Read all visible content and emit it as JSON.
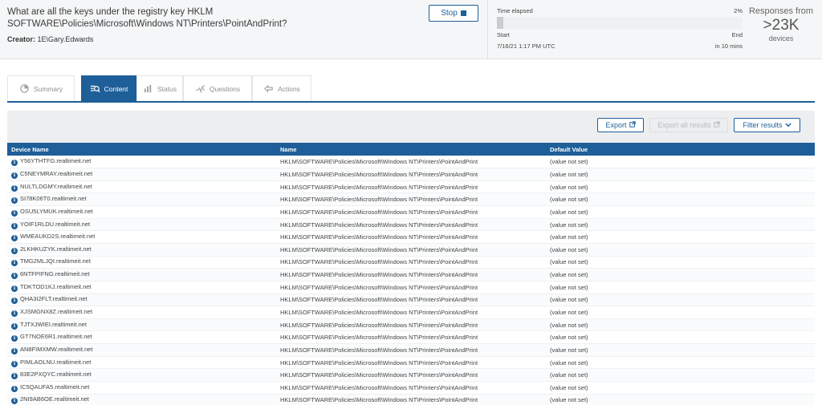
{
  "header": {
    "question": "What are all the keys under the registry key HKLM SOFTWARE\\Policies\\Microsoft\\Windows NT\\Printers\\PointAndPrint?",
    "creator_label": "Creator:",
    "creator_value": "1E\\Gary.Edwards",
    "stop_label": "Stop",
    "time_elapsed_label": "Time elapsed",
    "time_elapsed_percent": "2%",
    "progress_fraction": 0.02,
    "start_label": "Start",
    "end_label": "End",
    "start_time": "7/16/21 1:17 PM UTC",
    "end_time": "in 10 mins",
    "responses_label": "Responses from",
    "responses_count": ">23K",
    "responses_unit": "devices"
  },
  "tabs": [
    {
      "label": "Summary",
      "icon": "summary-icon",
      "active": false
    },
    {
      "label": "Content",
      "icon": "content-icon",
      "active": true
    },
    {
      "label": "Status",
      "icon": "status-icon",
      "active": false
    },
    {
      "label": "Questions",
      "icon": "questions-icon",
      "active": false
    },
    {
      "label": "Actions",
      "icon": "actions-icon",
      "active": false
    }
  ],
  "toolbar": {
    "export_label": "Export",
    "export_all_label": "Export all results",
    "filter_label": "Filter results"
  },
  "table": {
    "columns": [
      "Device Name",
      "Name",
      "Default Value"
    ],
    "rows": [
      {
        "device": "Y56YTHTFG.realtimeit.net",
        "name": "HKLM\\SOFTWARE\\Policies\\Microsoft\\Windows NT\\Printers\\PointAndPrint",
        "value": "(value not set)"
      },
      {
        "device": "C5NEYMRAY.realtimeit.net",
        "name": "HKLM\\SOFTWARE\\Policies\\Microsoft\\Windows NT\\Printers\\PointAndPrint",
        "value": "(value not set)"
      },
      {
        "device": "NULTLDGMY.realtimeit.net",
        "name": "HKLM\\SOFTWARE\\Policies\\Microsoft\\Windows NT\\Printers\\PointAndPrint",
        "value": "(value not set)"
      },
      {
        "device": "SI78K06T0.realtimeit.net",
        "name": "HKLM\\SOFTWARE\\Policies\\Microsoft\\Windows NT\\Printers\\PointAndPrint",
        "value": "(value not set)"
      },
      {
        "device": "OSU5LYMUK.realtimeit.net",
        "name": "HKLM\\SOFTWARE\\Policies\\Microsoft\\Windows NT\\Printers\\PointAndPrint",
        "value": "(value not set)"
      },
      {
        "device": "YOIF1RLDU.realtimeit.net",
        "name": "HKLM\\SOFTWARE\\Policies\\Microsoft\\Windows NT\\Printers\\PointAndPrint",
        "value": "(value not set)"
      },
      {
        "device": "WMEAUKD2S.realtimeit.net",
        "name": "HKLM\\SOFTWARE\\Policies\\Microsoft\\Windows NT\\Printers\\PointAndPrint",
        "value": "(value not set)"
      },
      {
        "device": "2LKHKUZYK.realtimeit.net",
        "name": "HKLM\\SOFTWARE\\Policies\\Microsoft\\Windows NT\\Printers\\PointAndPrint",
        "value": "(value not set)"
      },
      {
        "device": "TMG2MLJQI.realtimeit.net",
        "name": "HKLM\\SOFTWARE\\Policies\\Microsoft\\Windows NT\\Printers\\PointAndPrint",
        "value": "(value not set)"
      },
      {
        "device": "6NTFPIFNG.realtimeit.net",
        "name": "HKLM\\SOFTWARE\\Policies\\Microsoft\\Windows NT\\Printers\\PointAndPrint",
        "value": "(value not set)"
      },
      {
        "device": "TDKTOD1KJ.realtimeit.net",
        "name": "HKLM\\SOFTWARE\\Policies\\Microsoft\\Windows NT\\Printers\\PointAndPrint",
        "value": "(value not set)"
      },
      {
        "device": "QHA3I2FLT.realtimeit.net",
        "name": "HKLM\\SOFTWARE\\Policies\\Microsoft\\Windows NT\\Printers\\PointAndPrint",
        "value": "(value not set)"
      },
      {
        "device": "XJSMGNX8Z.realtimeit.net",
        "name": "HKLM\\SOFTWARE\\Policies\\Microsoft\\Windows NT\\Printers\\PointAndPrint",
        "value": "(value not set)"
      },
      {
        "device": "TJTXJWIEI.realtimeit.net",
        "name": "HKLM\\SOFTWARE\\Policies\\Microsoft\\Windows NT\\Printers\\PointAndPrint",
        "value": "(value not set)"
      },
      {
        "device": "GT7NOE6R1.realtimeit.net",
        "name": "HKLM\\SOFTWARE\\Policies\\Microsoft\\Windows NT\\Printers\\PointAndPrint",
        "value": "(value not set)"
      },
      {
        "device": "AN8FIMXMW.realtimeit.net",
        "name": "HKLM\\SOFTWARE\\Policies\\Microsoft\\Windows NT\\Printers\\PointAndPrint",
        "value": "(value not set)"
      },
      {
        "device": "PIMLAOLNU.realtimeit.net",
        "name": "HKLM\\SOFTWARE\\Policies\\Microsoft\\Windows NT\\Printers\\PointAndPrint",
        "value": "(value not set)"
      },
      {
        "device": "83E2PXQYC.realtimeit.net",
        "name": "HKLM\\SOFTWARE\\Policies\\Microsoft\\Windows NT\\Printers\\PointAndPrint",
        "value": "(value not set)"
      },
      {
        "device": "IC5QAUFA5.realtimeit.net",
        "name": "HKLM\\SOFTWARE\\Policies\\Microsoft\\Windows NT\\Printers\\PointAndPrint",
        "value": "(value not set)"
      },
      {
        "device": "2NI9AB6OE.realtimeit.net",
        "name": "HKLM\\SOFTWARE\\Policies\\Microsoft\\Windows NT\\Printers\\PointAndPrint",
        "value": "(value not set)"
      }
    ]
  },
  "colors": {
    "accent": "#1e5f99",
    "header_bg": "#f5f6f7",
    "toolbar_bg": "#eceef0"
  }
}
